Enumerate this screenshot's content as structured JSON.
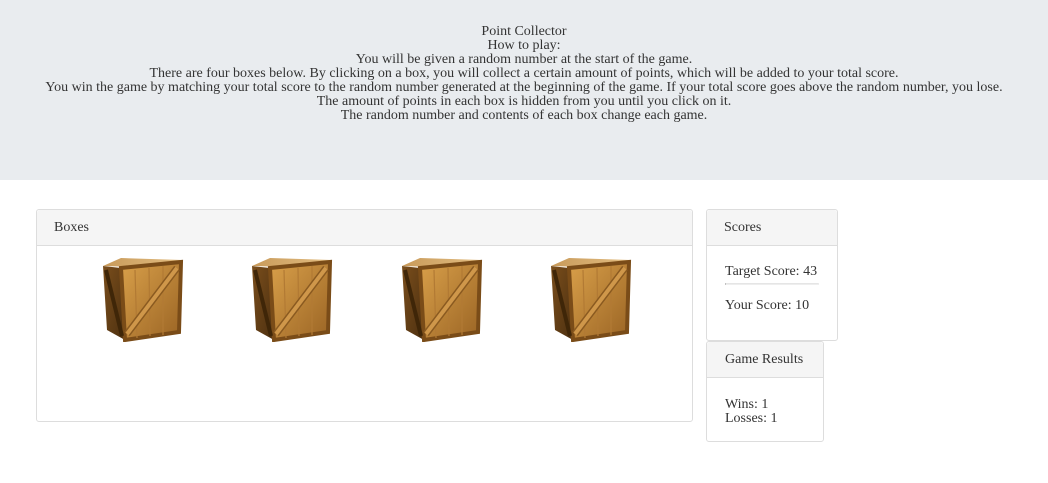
{
  "header": {
    "title": "Point Collector",
    "how_to_play": "How to play:",
    "lines": [
      "You will be given a random number at the start of the game.",
      "There are four boxes below. By clicking on a box, you will collect a certain amount of points, which will be added to your total score.",
      "You win the game by matching your total score to the random number generated at the beginning of the game. If your total score goes above the random number, you lose.",
      "The amount of points in each box is hidden from you until you click on it.",
      "The random number and contents of each box change each game."
    ]
  },
  "boxes": {
    "heading": "Boxes",
    "items": [
      {
        "icon": "wooden-crate-icon"
      },
      {
        "icon": "wooden-crate-icon"
      },
      {
        "icon": "wooden-crate-icon"
      },
      {
        "icon": "wooden-crate-icon"
      }
    ]
  },
  "scores": {
    "heading": "Scores",
    "target": "Target Score: 43",
    "yours": "Your Score: 10"
  },
  "results": {
    "heading": "Game Results",
    "wins": "Wins: 1",
    "losses": "Losses: 1"
  }
}
